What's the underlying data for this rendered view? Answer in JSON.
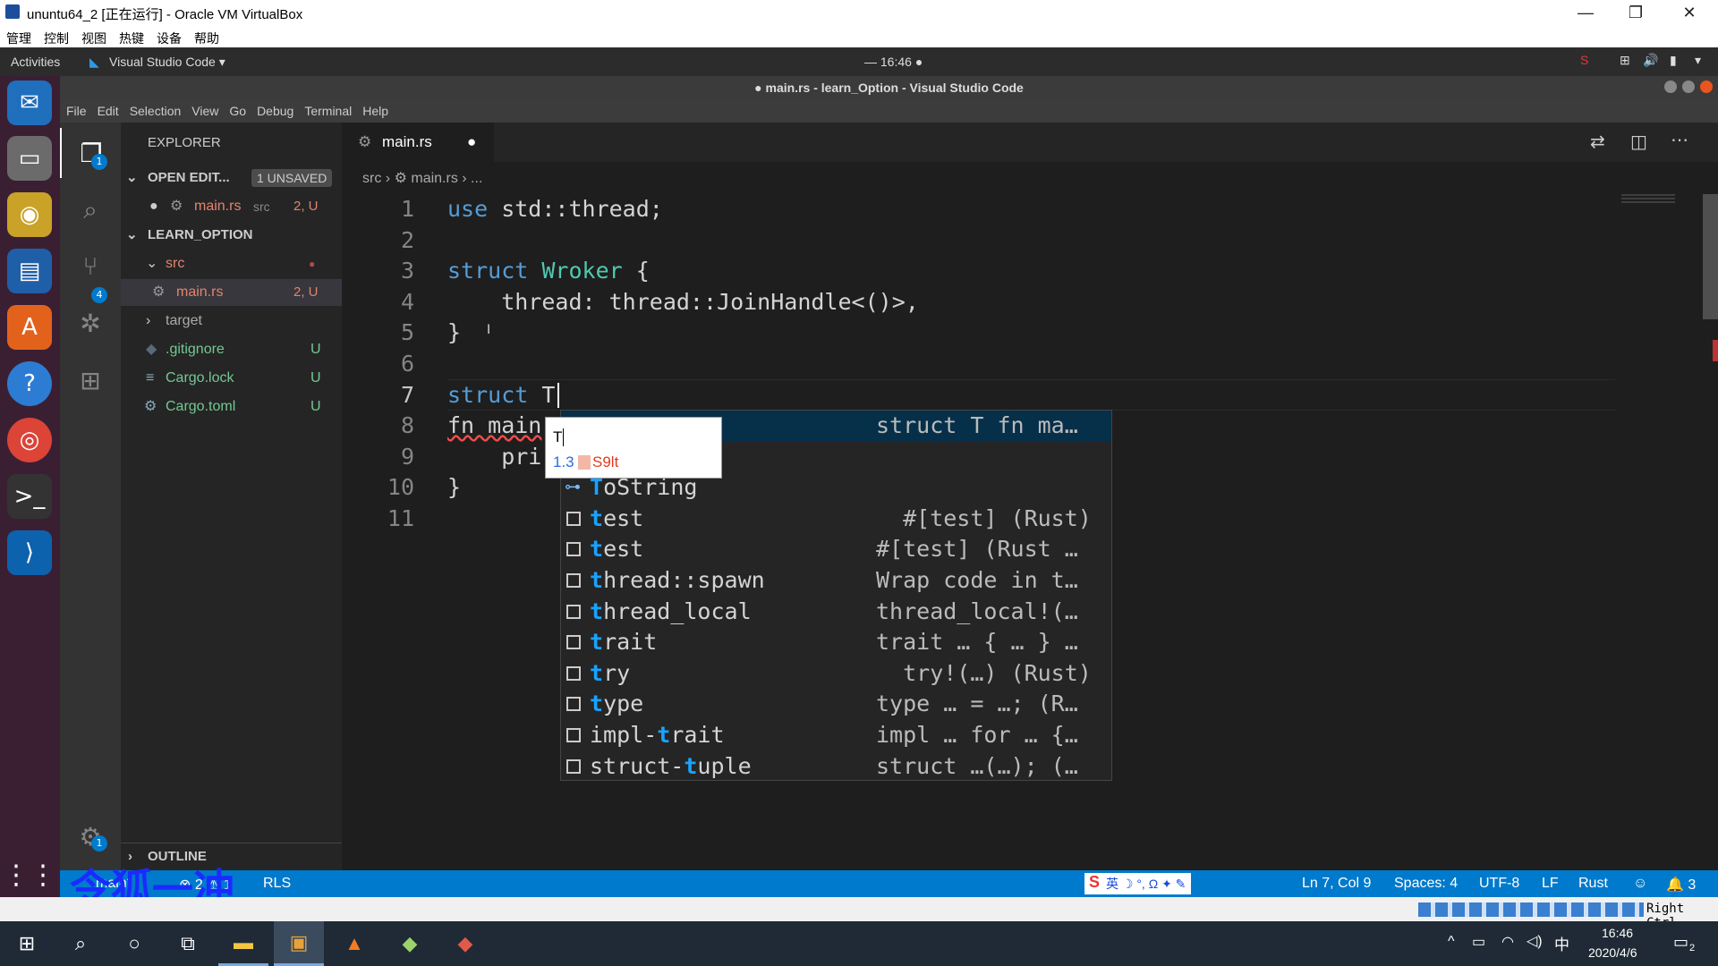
{
  "vbox": {
    "title": "ununtu64_2 [正在运行] - Oracle VM VirtualBox",
    "menu": [
      "管理",
      "控制",
      "视图",
      "热键",
      "设备",
      "帮助"
    ],
    "min": "—",
    "max": "❐",
    "close": "✕"
  },
  "gnome": {
    "activities": "Activities",
    "app": "Visual Studio Code ▾",
    "clock": "— 16:46 ●"
  },
  "vscode": {
    "window_title": "● main.rs - learn_Option - Visual Studio Code",
    "menu": [
      "File",
      "Edit",
      "Selection",
      "View",
      "Go",
      "Debug",
      "Terminal",
      "Help"
    ],
    "activity_badges": {
      "explorer": "1",
      "scm": "4",
      "settings": "1"
    },
    "sidebar": {
      "title": "EXPLORER",
      "open_editors": "OPEN EDIT...",
      "unsaved": "1 UNSAVED",
      "open_file": "main.rs",
      "open_file_dir": "src",
      "open_file_status": "2, U",
      "project": "LEARN_OPTION",
      "src": "src",
      "main_file": "main.rs",
      "main_status": "2, U",
      "target": "target",
      "gitignore": ".gitignore",
      "cargo_lock": "Cargo.lock",
      "cargo_toml": "Cargo.toml",
      "u": "U",
      "outline": "OUTLINE"
    },
    "tab": {
      "label": "main.rs",
      "dirty": "●"
    },
    "breadcrumb": {
      "a": "src",
      "b": "main.rs",
      "c": "..."
    },
    "lines": [
      "1",
      "2",
      "3",
      "4",
      "5",
      "6",
      "7",
      "8",
      "9",
      "10",
      "11"
    ],
    "code": {
      "l1a": "use",
      "l1b": " std::thread;",
      "l3a": "struct",
      "l3b": " ",
      "l3c": "Wroker",
      "l3d": " {",
      "l4": "    thread: thread::JoinHandle<()>,",
      "l5": "}",
      "l7a": "struct",
      "l7b": " T",
      "l8": "fn main",
      "l9": "    pri",
      "l10": "}"
    },
    "suggest": [
      {
        "hl": "",
        "rest": "",
        "det": "struct T fn ma…"
      },
      {
        "hl": "",
        "rest": "",
        "det": ""
      },
      {
        "hl": "T",
        "rest": "oString",
        "det": ""
      },
      {
        "hl": "t",
        "rest": "est",
        "det": "  #[test] (Rust)"
      },
      {
        "hl": "t",
        "rest": "est",
        "det": "#[test] (Rust …"
      },
      {
        "hl": "t",
        "rest": "hread::spawn",
        "det": "Wrap code in t…"
      },
      {
        "hl": "t",
        "rest": "hread_local",
        "det": "thread_local!(…"
      },
      {
        "hl": "t",
        "rest": "rait",
        "det": "trait … { … } …"
      },
      {
        "hl": "t",
        "rest": "ry",
        "det": "  try!(…) (Rust)"
      },
      {
        "hl": "t",
        "rest": "ype",
        "det": "type … = …; (R…"
      },
      {
        "pre": "impl-",
        "hl": "t",
        "rest": "rait",
        "det": "impl … for … {…"
      },
      {
        "pre": "struct-",
        "hl": "t",
        "rest": "uple",
        "det": "struct …(…); (…"
      }
    ],
    "ime": {
      "input": "T",
      "cand_num": "1.3",
      "cand": "S9lt"
    },
    "status": {
      "branch": "main*",
      "errors": "⊗ 2 ⚠ 1",
      "rls": "RLS",
      "ime_bar": "英 ☽ °, Ω ✦ ✎",
      "pos": "Ln 7, Col 9",
      "spaces": "Spaces: 4",
      "enc": "UTF-8",
      "eol": "LF",
      "lang": "Rust",
      "bell": "🔔 3"
    }
  },
  "vbox_status": {
    "hostkey": "Right Ctrl"
  },
  "taskbar": {
    "time": "16:46",
    "date": "2020/4/6",
    "ime": "中",
    "notif": "2"
  },
  "watermark": "令狐一冲"
}
